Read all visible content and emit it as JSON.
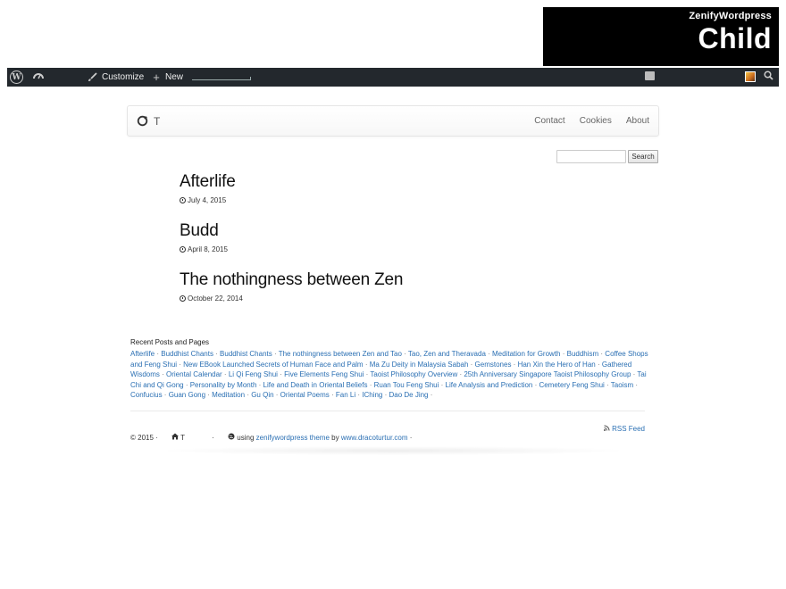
{
  "banner": {
    "line1": "ZenifyWordpress",
    "line2": "Child"
  },
  "adminbar": {
    "customize_label": "Customize",
    "new_label": "New",
    "icons": [
      "wordpress-icon",
      "dashboard-icon",
      "brush-icon",
      "plus-icon",
      "comment-icon",
      "avatar",
      "search-icon"
    ]
  },
  "navbar": {
    "brand": "T",
    "links": [
      "Contact",
      "Cookies",
      "About"
    ]
  },
  "search": {
    "button_label": "Search",
    "placeholder": ""
  },
  "posts": [
    {
      "title": "Afterlife",
      "date": "July 4, 2015"
    },
    {
      "title": "Budd",
      "date": "April 8, 2015"
    },
    {
      "title": "The nothingness between Zen",
      "date": "October 22, 2014"
    }
  ],
  "recent": {
    "title": "Recent Posts and Pages",
    "items": [
      "Afterlife",
      "Buddhist Chants",
      "Buddhist Chants",
      "The nothingness between Zen and Tao",
      "Tao, Zen and Theravada",
      "Meditation for Growth",
      "Buddhism",
      "Coffee Shops and Feng Shui",
      "New EBook Launched Secrets of Human Face and Palm",
      "Ma Zu Deity in Malaysia Sabah",
      "Gemstones",
      "Han Xin the Hero of Han",
      "Gathered Wisdoms",
      "Oriental Calendar",
      "Li Qi Feng Shui",
      "Five Elements Feng Shui",
      "Taoist Philosophy Overview",
      "25th Anniversary Singapore Taoist Philosophy Group",
      "Tai Chi and Qi Gong",
      "Personality by Month",
      "Life and Death in Oriental Beliefs",
      "Ruan Tou Feng Shui",
      "Life Analysis and Prediction",
      "Cemetery Feng Shui",
      "Taoism",
      "Confucius",
      "Guan Gong",
      "Meditation",
      "Gu Qin",
      "Oriental Poems",
      "Fan Li",
      "IChing",
      "Dao De Jing"
    ]
  },
  "footer": {
    "copyright": "© 2015 ·",
    "brand": "T",
    "using_prefix": "· ",
    "using_text": "using",
    "theme_link": "zenifywordpress theme",
    "by_text": "by",
    "author_link": "www.dracoturtur.com",
    "trailing": " ·",
    "rss": "RSS Feed"
  },
  "colors": {
    "link": "#2a6fb3",
    "adminbar": "#23282d",
    "banner": "#000000"
  }
}
